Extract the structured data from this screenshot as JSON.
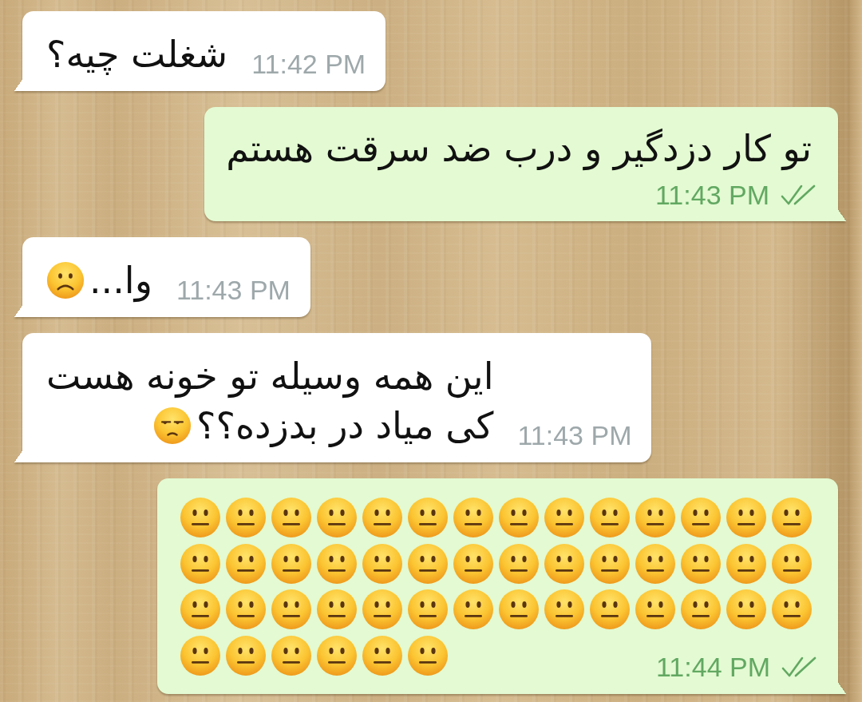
{
  "messages": [
    {
      "kind": "incoming",
      "lines": [
        "شغلت چیه؟"
      ],
      "time": "11:42 PM"
    },
    {
      "kind": "outgoing",
      "lines": [
        "تو کار دزدگیر و درب ضد سرقت هستم"
      ],
      "time": "11:43 PM",
      "delivered": true
    },
    {
      "kind": "incoming",
      "lines": [
        "وا..."
      ],
      "emojis": [
        {
          "kind": "frowning"
        }
      ],
      "time": "11:43 PM"
    },
    {
      "kind": "incoming",
      "lines": [
        "این همه وسیله تو خونه هست",
        "کی میاد در بدزده؟؟"
      ],
      "emojis": [
        {
          "kind": "unamused"
        }
      ],
      "time": "11:43 PM"
    },
    {
      "kind": "outgoing",
      "emojis": [
        {
          "kind": "neutral"
        },
        {
          "kind": "neutral"
        },
        {
          "kind": "neutral"
        },
        {
          "kind": "neutral"
        },
        {
          "kind": "neutral"
        },
        {
          "kind": "neutral"
        },
        {
          "kind": "neutral"
        },
        {
          "kind": "neutral"
        },
        {
          "kind": "neutral"
        },
        {
          "kind": "neutral"
        },
        {
          "kind": "neutral"
        },
        {
          "kind": "neutral"
        },
        {
          "kind": "neutral"
        },
        {
          "kind": "neutral"
        },
        {
          "kind": "neutral"
        },
        {
          "kind": "neutral"
        },
        {
          "kind": "neutral"
        },
        {
          "kind": "neutral"
        },
        {
          "kind": "neutral"
        },
        {
          "kind": "neutral"
        },
        {
          "kind": "neutral"
        },
        {
          "kind": "neutral"
        },
        {
          "kind": "neutral"
        },
        {
          "kind": "neutral"
        },
        {
          "kind": "neutral"
        },
        {
          "kind": "neutral"
        },
        {
          "kind": "neutral"
        },
        {
          "kind": "neutral"
        },
        {
          "kind": "neutral"
        },
        {
          "kind": "neutral"
        },
        {
          "kind": "neutral"
        },
        {
          "kind": "neutral"
        },
        {
          "kind": "neutral"
        },
        {
          "kind": "neutral"
        },
        {
          "kind": "neutral"
        },
        {
          "kind": "neutral"
        },
        {
          "kind": "neutral"
        },
        {
          "kind": "neutral"
        },
        {
          "kind": "neutral"
        },
        {
          "kind": "neutral"
        },
        {
          "kind": "neutral"
        },
        {
          "kind": "neutral"
        },
        {
          "kind": "neutral"
        },
        {
          "kind": "neutral"
        },
        {
          "kind": "neutral"
        },
        {
          "kind": "neutral"
        },
        {
          "kind": "neutral"
        },
        {
          "kind": "neutral"
        }
      ],
      "time": "11:44 PM",
      "delivered": true
    }
  ]
}
